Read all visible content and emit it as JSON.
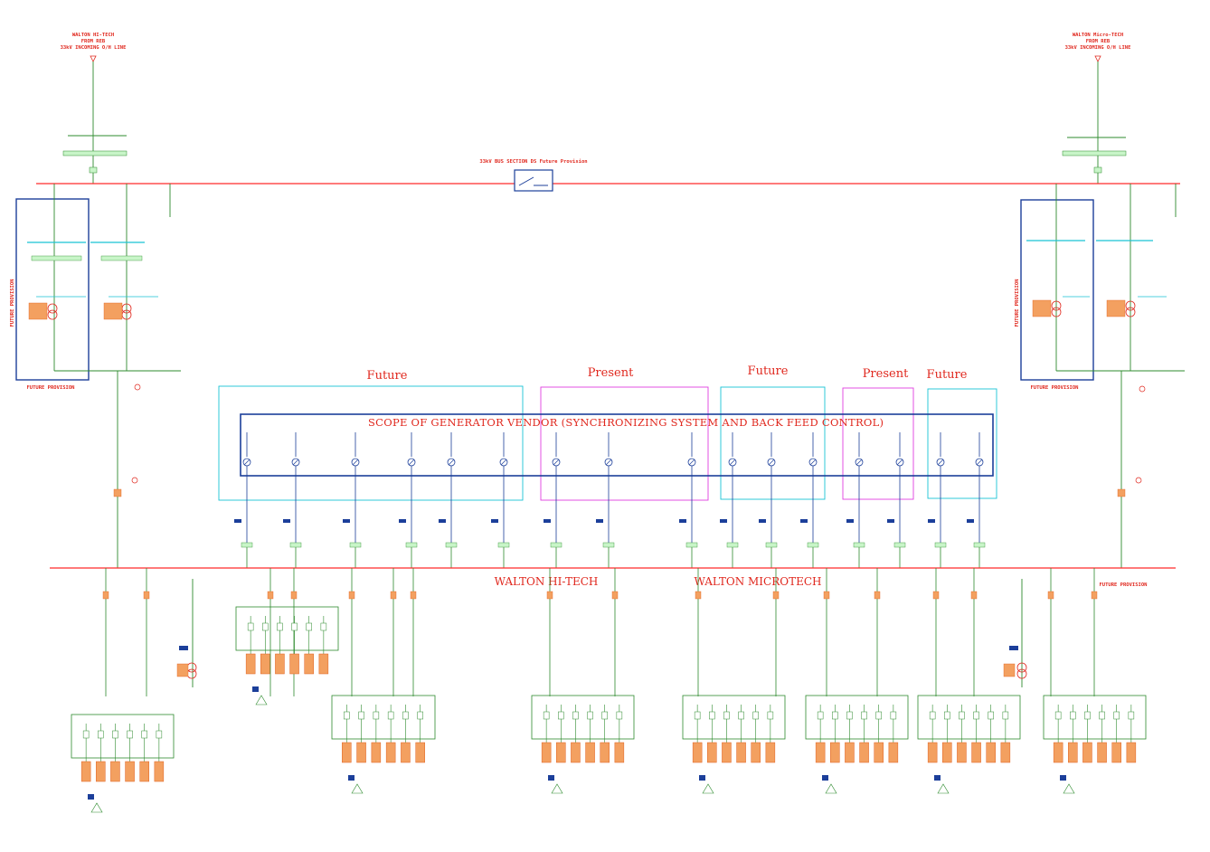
{
  "incomers": {
    "left": [
      "WALTON HI-TECH",
      "FROM REB",
      "33kV INCOMING O/H LINE"
    ],
    "right": [
      "WALTON Micro-TECH",
      "FROM REB",
      "33kV INCOMING O/H LINE"
    ]
  },
  "bus_section_label": "33kV BUS SECTION DS Future Provision",
  "future_provision_vertical": "FUTURE PROVISION",
  "future_provision_bottom": "FUTURE PROVISION",
  "future_provision_right": "FUTURE PROVISION",
  "zone_labels": {
    "z1": "Future",
    "z2": "Present",
    "z3": "Future",
    "z4": "Present",
    "z5": "Future"
  },
  "vendor_scope": "SCOPE OF GENERATOR VENDOR (SYNCHRONIZING SYSTEM AND BACK FEED CONTROL)",
  "lv_bus_left": "WALTON HI-TECH",
  "lv_bus_right": "WALTON MICROTECH",
  "colors": {
    "bus": "#ff2a2a",
    "feeder": "#2e8b2e",
    "cyan": "#19c3d4",
    "blue": "#1c3f9a",
    "magenta": "#e040e0",
    "label": "#e0281e",
    "tag_fill": "#c8f5c8",
    "panel": "#e06020"
  }
}
